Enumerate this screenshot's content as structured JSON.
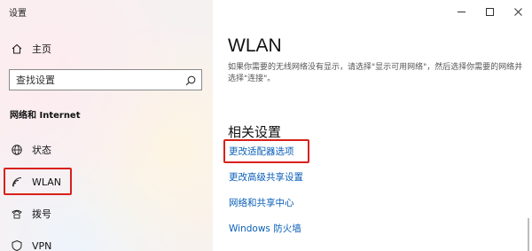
{
  "window": {
    "title": "设置"
  },
  "sidebar": {
    "home_label": "主页",
    "search_placeholder": "查找设置",
    "section_title": "网络和 Internet",
    "items": [
      {
        "label": "状态",
        "icon": "globe-icon"
      },
      {
        "label": "WLAN",
        "icon": "wifi-icon",
        "selected": true
      },
      {
        "label": "拨号",
        "icon": "dialup-icon"
      },
      {
        "label": "VPN",
        "icon": "vpn-icon"
      }
    ]
  },
  "main": {
    "title": "WLAN",
    "description": "如果你需要的无线网络没有显示，请选择\"显示可用网络\"，然后选择你需要的网络并选择\"连接\"。",
    "related_title": "相关设置",
    "links": [
      {
        "label": "更改适配器选项",
        "highlighted": true
      },
      {
        "label": "更改高级共享设置"
      },
      {
        "label": "网络和共享中心"
      },
      {
        "label": "Windows 防火墙"
      }
    ]
  },
  "colors": {
    "accent": "#0a5fb8",
    "highlight_border": "#d9211b"
  }
}
